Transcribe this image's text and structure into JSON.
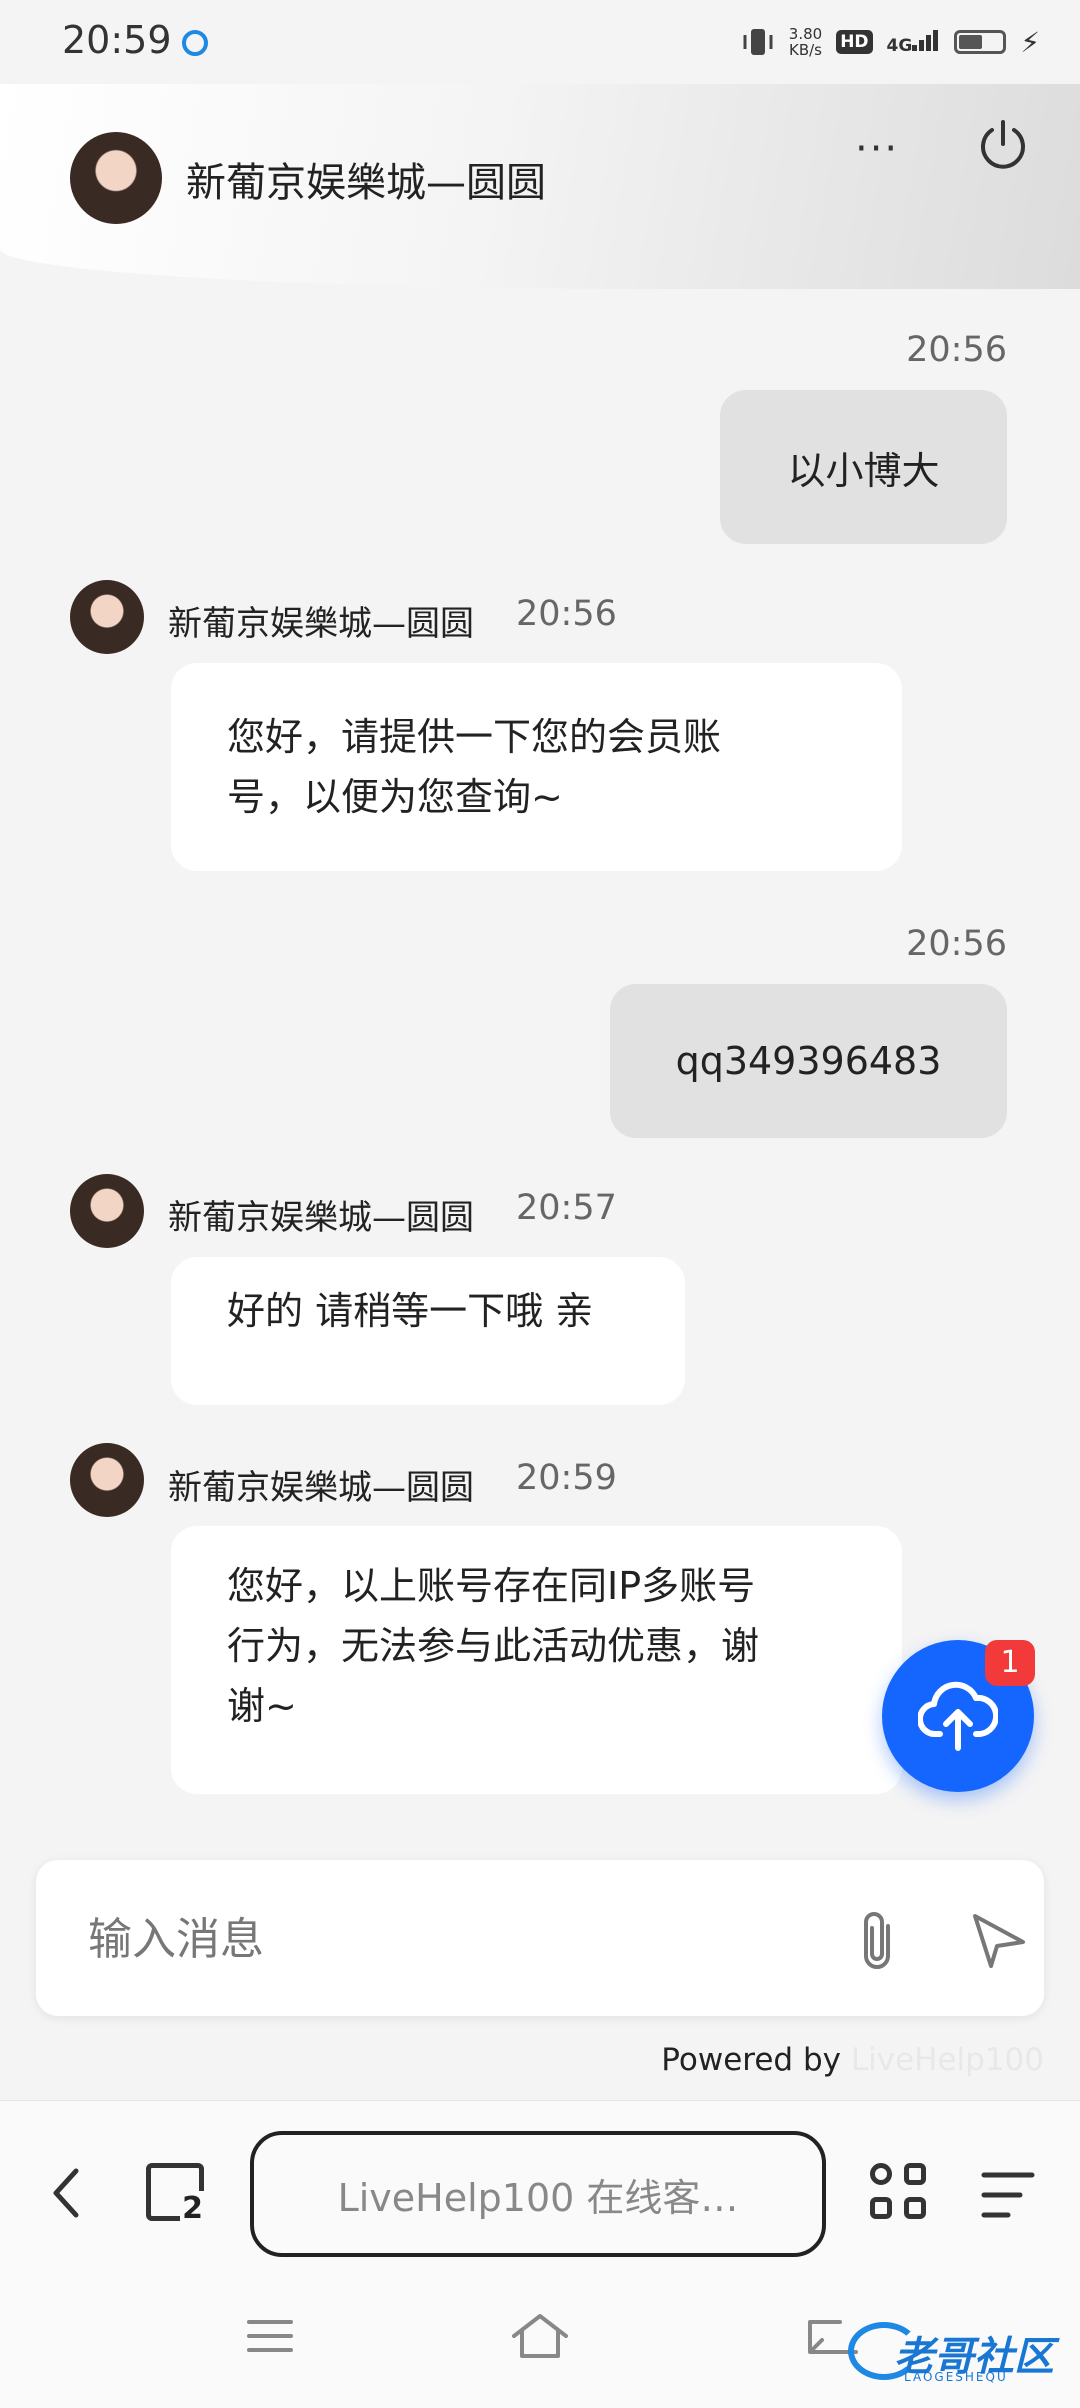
{
  "status_bar": {
    "time": "20:59",
    "net_speed_value": "3.80",
    "net_speed_unit": "KB/s",
    "hd_label": "HD",
    "network": "4G",
    "battery_level": 0.55
  },
  "header": {
    "title": "新葡京娱樂城—圆圆",
    "more_label": "···"
  },
  "messages": [
    {
      "from": "user",
      "time": "20:56",
      "text": "以小博大"
    },
    {
      "from": "agent",
      "name": "新葡京娱樂城—圆圆",
      "time": "20:56",
      "lines": [
        "您好，请提供一下您的会员账",
        "号，以便为您查询~"
      ]
    },
    {
      "from": "user",
      "time": "20:56",
      "text": "qq349396483"
    },
    {
      "from": "agent",
      "name": "新葡京娱樂城—圆圆",
      "time": "20:57",
      "lines": [
        "好的 请稍等一下哦 亲"
      ]
    },
    {
      "from": "agent",
      "name": "新葡京娱樂城—圆圆",
      "time": "20:59",
      "lines": [
        "您好，以上账号存在同IP多账号",
        "行为，无法参与此活动优惠，谢",
        "谢~"
      ]
    }
  ],
  "upload": {
    "badge": "1"
  },
  "composer": {
    "placeholder": "输入消息"
  },
  "footer": {
    "powered_by": "Powered by",
    "brand": "LiveHelp100"
  },
  "browser": {
    "url_text": "LiveHelp100 在线客…",
    "tab_count": "2"
  },
  "watermark": {
    "text": "老哥社区",
    "sub": "LAOGESHEQU"
  },
  "colors": {
    "accent": "#1565ff",
    "badge": "#f23a3a",
    "bubble_out": "#e1e1e1",
    "bubble_in": "#ffffff"
  }
}
